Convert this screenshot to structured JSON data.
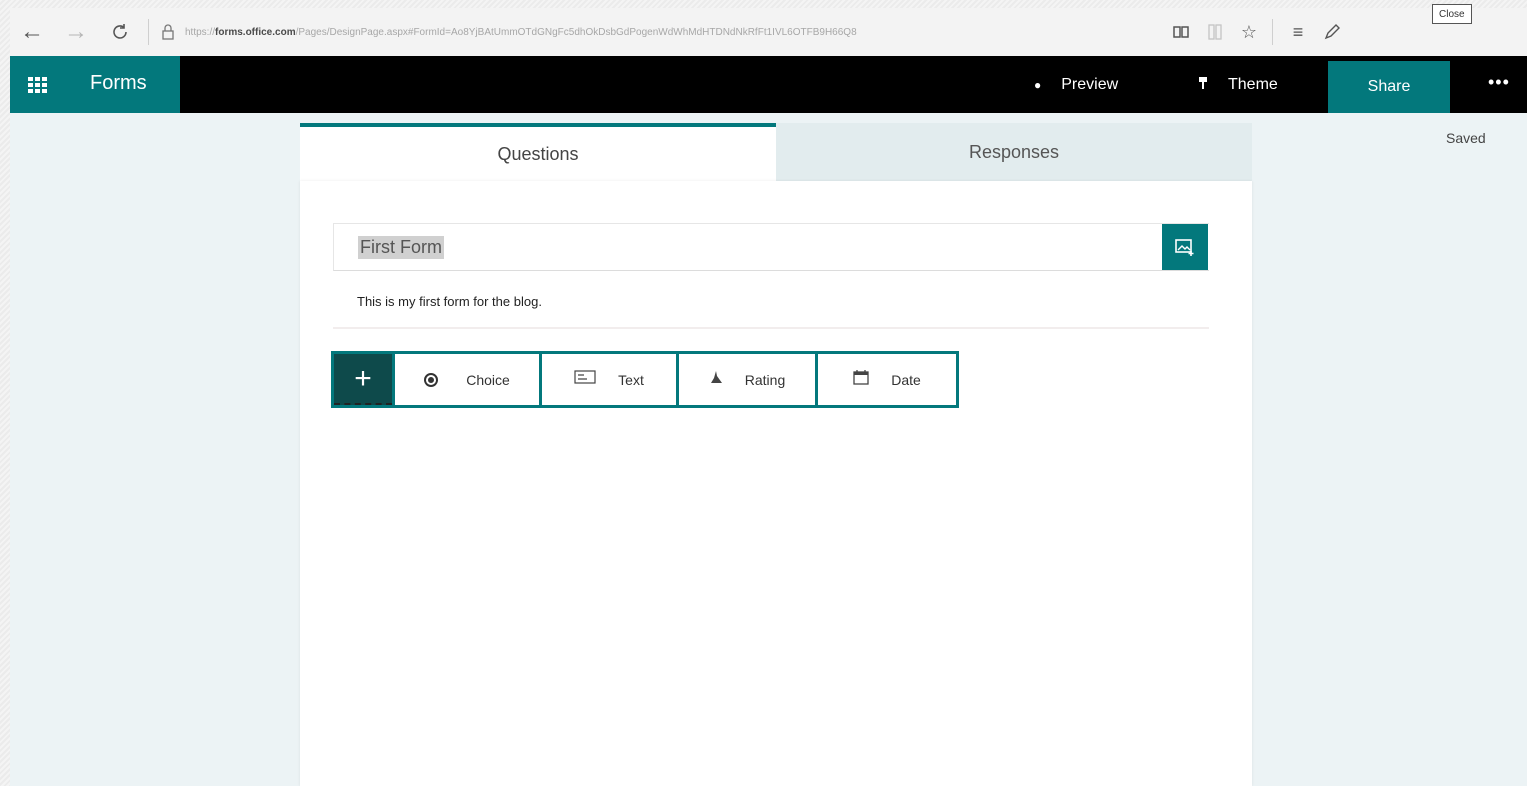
{
  "browser": {
    "url_host": "forms.office.com",
    "url_pre": "https://",
    "url_rest": "/Pages/DesignPage.aspx#FormId=Ao8YjBAtUmmOTdGNgFc5dhOkDsbGdPogenWdWhMdHTDNdNkRfFt1IVL6OTFB9H66Q8",
    "close_tooltip": "Close"
  },
  "appbar": {
    "brand": "Forms",
    "preview_label": "Preview",
    "theme_label": "Theme",
    "share_label": "Share",
    "more_label": "•••"
  },
  "status": {
    "saved": "Saved"
  },
  "tabs": [
    {
      "label": "Questions",
      "active": true
    },
    {
      "label": "Responses",
      "active": false
    }
  ],
  "form": {
    "title": "First Form",
    "description": "This is my first form for the blog."
  },
  "question_types": [
    {
      "label": "Choice",
      "icon": "radio-icon"
    },
    {
      "label": "Text",
      "icon": "text-icon"
    },
    {
      "label": "Rating",
      "icon": "rating-icon"
    },
    {
      "label": "Date",
      "icon": "calendar-icon"
    }
  ],
  "colors": {
    "accent": "#03787c",
    "appbar": "#000000",
    "background": "#ecf3f5"
  }
}
